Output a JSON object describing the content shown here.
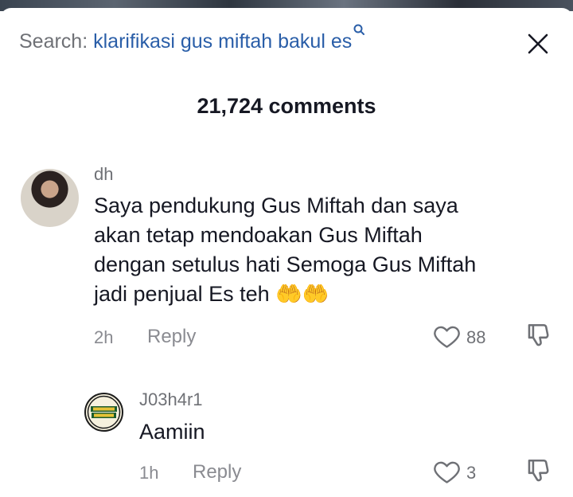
{
  "search": {
    "prefix": "Search: ",
    "query": "klarifikasi gus miftah bakul es"
  },
  "comments_count": "21,724 comments",
  "comments": [
    {
      "username": "dh",
      "text": "Saya pendukung Gus Miftah dan saya akan tetap mendoakan Gus Miftah dengan setulus hati Semoga Gus Miftah jadi penjual Es teh 🤲🤲",
      "line1": "Saya pendukung Gus Miftah dan saya",
      "line2": "akan tetap mendoakan Gus Miftah",
      "line3": "dengan setulus hati Semoga Gus Miftah",
      "line4": "jadi penjual Es teh 🤲🤲",
      "time": "2h",
      "reply_label": "Reply",
      "likes": "88"
    },
    {
      "username": "J03h4r1",
      "text": "Aamiin",
      "time": "1h",
      "reply_label": "Reply",
      "likes": "3"
    }
  ],
  "colors": {
    "query_blue": "#2a5ea8",
    "gray_text": "#8a8b91",
    "dark_text": "#161823"
  },
  "icons": [
    "search-icon",
    "close-icon",
    "heart-icon",
    "dislike-icon"
  ]
}
